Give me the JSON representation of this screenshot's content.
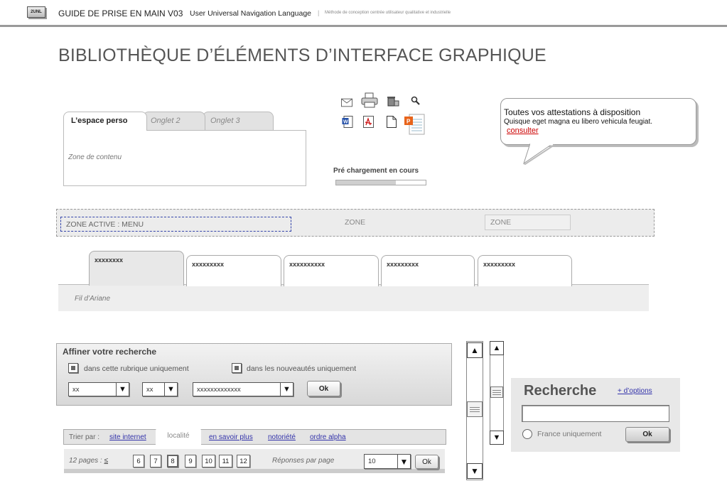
{
  "header": {
    "logo": "2UNL",
    "title": "GUIDE DE PRISE EN MAIN V03",
    "subtitle": "User Universal Navigation Language",
    "separator": "|",
    "description": "Méthode de conception centrée utilisateur qualitative et industrielle"
  },
  "page_title": "BIBLIOTHÈQUE D’ÉLÉMENTS D’INTERFACE GRAPHIQUE",
  "tabs_widget": {
    "tabs": [
      "L’espace perso",
      "Onglet  2",
      "Onglet 3"
    ],
    "content": "Zone de contenu"
  },
  "icons": {
    "row1": [
      "mail-icon",
      "print-icon",
      "delete-icon",
      "zoom-icon"
    ],
    "row2": [
      "word-doc-icon",
      "pdf-icon",
      "text-doc-icon",
      "powerpoint-icon"
    ]
  },
  "preload": {
    "label": "Pré chargement en cours",
    "progress": 0.67
  },
  "bubble": {
    "title": "Toutes vos attestations à disposition",
    "text": "Quisque eget magna eu libero vehicula feugiat.",
    "link": "consulter"
  },
  "zones": {
    "active": "ZONE ACTIVE : MENU",
    "zone2": "ZONE",
    "zone3": "ZONE"
  },
  "nav": {
    "tabs": [
      "xxxxxxxx",
      "xxxxxxxxx",
      "xxxxxxxxxx",
      "xxxxxxxxx",
      "xxxxxxxxx"
    ],
    "breadcrumb": "Fil d’Ariane"
  },
  "refine": {
    "title": "Affiner votre recherche",
    "check1": "dans cette rubrique uniquement",
    "check2": "dans les nouveautés uniquement",
    "select1": "xx",
    "select2": "xx",
    "select3": "xxxxxxxxxxxxx",
    "ok": "Ok"
  },
  "sort": {
    "label": "Trier par :",
    "links": [
      "site internet",
      "localité",
      "en savoir plus",
      "notoriété",
      "ordre alpha"
    ],
    "active_index": 1
  },
  "pager": {
    "pages_label": "12 pages :",
    "prev": "≤",
    "pages": [
      "6",
      "7",
      "8",
      "9",
      "10",
      "11",
      "12"
    ],
    "current": "8",
    "per_page_label": "Réponses par page",
    "per_page_value": "10",
    "ok": "Ok"
  },
  "search": {
    "title": "Recherche",
    "more": "+ d’options",
    "radio_label": "France uniquement",
    "ok": "Ok"
  },
  "colors": {
    "link": "#3333aa",
    "alert_link": "#cc0000",
    "dashed_zone": "#3344aa"
  }
}
